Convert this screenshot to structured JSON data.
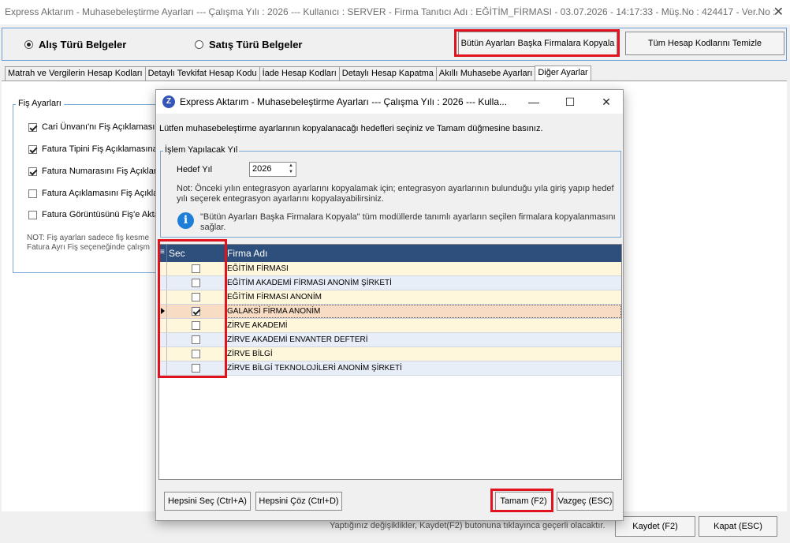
{
  "main_window": {
    "title": "Express Aktarım - Muhasebeleştirme Ayarları  ---  Çalışma Yılı : 2026  ---  Kullanıcı : SERVER - Firma Tanıtıcı Adı : EĞİTİM_FİRMASI - 03.07.2026 - 14:17:33 - Müş.No : 424417 - Ver.No :",
    "close_glyph": "✕"
  },
  "type_selector": {
    "alis_label": "Alış Türü Belgeler",
    "satis_label": "Satış Türü Belgeler",
    "selected": "alis"
  },
  "toolbar": {
    "copy_all_label": "Bütün Ayarları Başka Firmalara Kopyala",
    "clear_codes_label": "Tüm Hesap Kodlarını Temizle"
  },
  "tabs": [
    {
      "label": "Matrah ve Vergilerin Hesap Kodları",
      "active": false
    },
    {
      "label": "Detaylı Tevkifat Hesap Kodu",
      "active": false
    },
    {
      "label": "İade Hesap Kodları",
      "active": false
    },
    {
      "label": "Detaylı Hesap Kapatma",
      "active": false
    },
    {
      "label": "Akıllı Muhasebe Ayarları",
      "active": false
    },
    {
      "label": "Diğer Ayarlar",
      "active": true
    }
  ],
  "fis_ayarlari": {
    "legend": "Fiş Ayarları",
    "options": [
      {
        "label": "Cari Ünvanı'nı Fiş Açıklamasına",
        "checked": true
      },
      {
        "label": "Fatura Tipini Fiş Açıklamasına A",
        "checked": true
      },
      {
        "label": "Fatura Numarasını Fiş Açıklama",
        "checked": true
      },
      {
        "label": "Fatura Açıklamasını Fiş Açıklam",
        "checked": false
      },
      {
        "label": "Fatura Görüntüsünü Fiş'e Akta",
        "checked": false
      }
    ],
    "note_line1": "NOT: Fiş ayarları sadece fiş kesme",
    "note_line2": "Fatura Ayrı Fiş seçeneğinde çalışm"
  },
  "footer": {
    "note": "Yaptığınız değişiklikler, Kaydet(F2) butonuna tıklayınca geçerli olacaktır.",
    "save_label": "Kaydet (F2)",
    "close_label": "Kapat (ESC)"
  },
  "dialog": {
    "title": "Express Aktarım - Muhasebeleştirme Ayarları  ---  Çalışma Yılı : 2026  ---  Kulla...",
    "logo_letter": "Z",
    "minimize_glyph": "—",
    "maximize_glyph": "☐",
    "close_glyph": "✕",
    "instruction": "Lütfen muhasebeleştirme ayarlarının kopyalanacağı hedefleri seçiniz ve Tamam düğmesine basınız.",
    "islem_legend": "İşlem Yapılacak Yıl",
    "hedef_yil_label": "Hedef Yıl",
    "hedef_yil_value": "2026",
    "spin_up": "▲",
    "spin_down": "▼",
    "note_line1": "Not: Önceki yılın entegrasyon ayarlarını kopyalamak için; entegrasyon ayarlarının bulunduğu yıla giriş yapıp hedef",
    "note_line2": "yılı seçerek entegrasyon ayarlarını kopyalayabilirsiniz.",
    "info_glyph": "i",
    "info_line1": "\"Bütün Ayarları Başka Firmalara Kopyala\" tüm modüllerde tanımlı ayarların seçilen firmalara kopyalanmasını",
    "info_line2": "sağlar.",
    "grid": {
      "col_sec": "Sec",
      "col_firma": "Firma Adı",
      "rows": [
        {
          "name": "EĞİTİM FİRMASI",
          "checked": false
        },
        {
          "name": "EĞİTİM AKADEMİ FİRMASI ANONİM ŞİRKETİ",
          "checked": false
        },
        {
          "name": "EĞİTİM FİRMASI ANONİM",
          "checked": false
        },
        {
          "name": "GALAKSİ FİRMA ANONİM",
          "checked": true
        },
        {
          "name": "ZİRVE AKADEMİ",
          "checked": false
        },
        {
          "name": "ZİRVE AKADEMİ ENVANTER DEFTERİ",
          "checked": false
        },
        {
          "name": "ZİRVE BİLGİ",
          "checked": false
        },
        {
          "name": "ZİRVE BİLGİ TEKNOLOJİLERİ ANONİM ŞİRKETİ",
          "checked": false
        }
      ]
    },
    "select_all_label": "Hepsini Seç (Ctrl+A)",
    "deselect_all_label": "Hepsini Çöz (Ctrl+D)",
    "ok_label": "Tamam (F2)",
    "cancel_label": "Vazgeç (ESC)"
  }
}
